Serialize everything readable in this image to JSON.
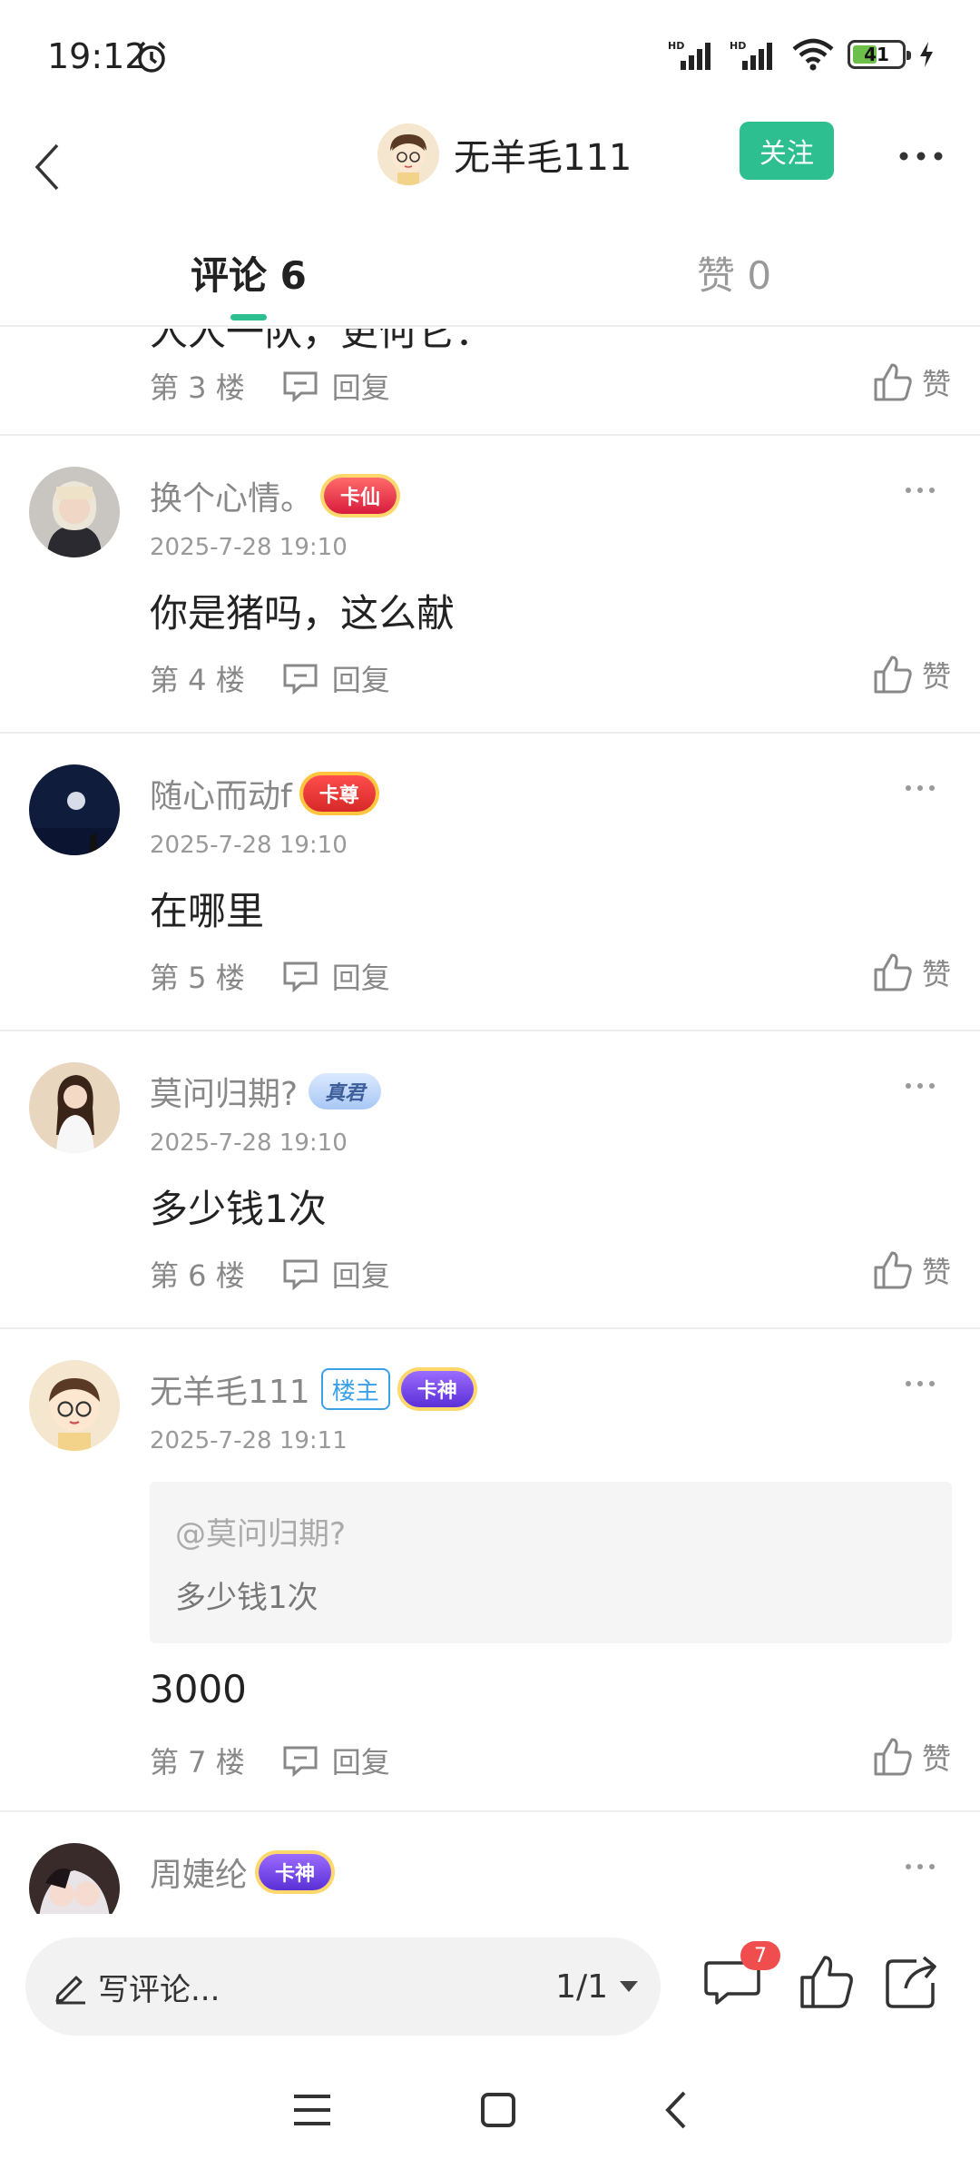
{
  "status": {
    "time": "19:12",
    "net1": "HD",
    "net2": "HD",
    "battery": "41"
  },
  "header": {
    "name": "无羊毛111",
    "follow": "关注"
  },
  "tabs": {
    "comments": "评论 6",
    "likes": "赞 0"
  },
  "partial": {
    "text": "人人一队，更何它：",
    "floor": "第 3 楼",
    "reply": "回复",
    "like": "赞"
  },
  "comments": [
    {
      "name": "换个心情。",
      "badge": "卡仙",
      "time": "2025-7-28 19:10",
      "text": "你是猪吗，这么献",
      "floor": "第 4 楼",
      "reply": "回复",
      "like": "赞"
    },
    {
      "name": "随心而动f",
      "badge": "卡尊",
      "time": "2025-7-28 19:10",
      "text": "在哪里",
      "floor": "第 5 楼",
      "reply": "回复",
      "like": "赞"
    },
    {
      "name": "莫问归期?",
      "badge": "真君",
      "time": "2025-7-28 19:10",
      "text": "多少钱1次",
      "floor": "第 6 楼",
      "reply": "回复",
      "like": "赞"
    },
    {
      "name": "无羊毛111",
      "op": "楼主",
      "badge": "卡神",
      "time": "2025-7-28 19:11",
      "quote_user": "@莫问归期?",
      "quote_text": "多少钱1次",
      "text": "3000",
      "floor": "第 7 楼",
      "reply": "回复",
      "like": "赞"
    },
    {
      "name": "周婕纶",
      "badge": "卡神"
    }
  ],
  "bottom": {
    "placeholder": "写评论...",
    "pager": "1/1",
    "comment_count": "7"
  },
  "colors": {
    "accent": "#2dbf8f",
    "red_badge": "#f04e4e",
    "op_blue": "#3aa0e8"
  }
}
